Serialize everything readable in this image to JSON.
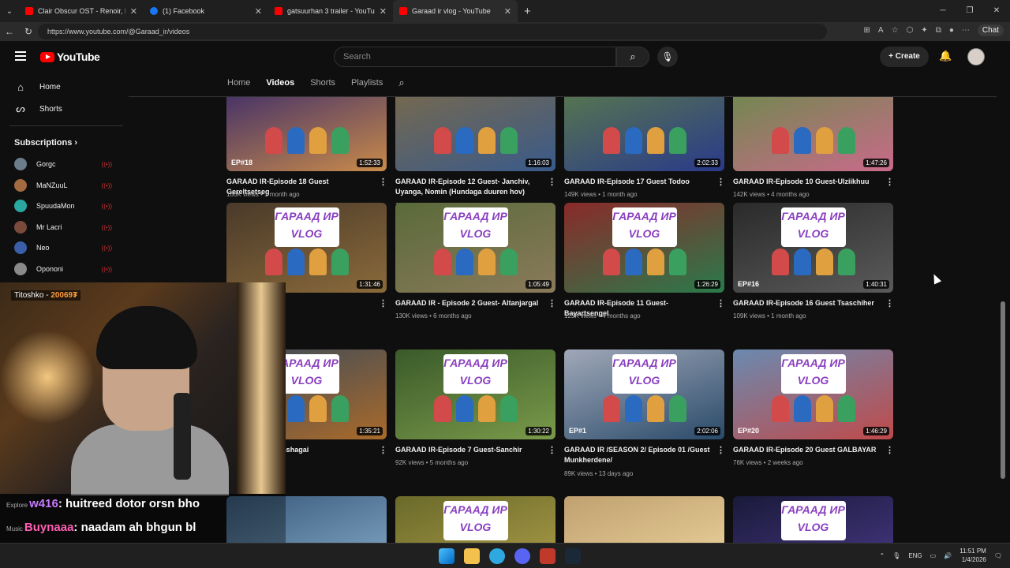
{
  "browser": {
    "tabs": [
      {
        "title": "Clair Obscur OST - Renoir, Il",
        "color": "#ff0000"
      },
      {
        "title": "(1) Facebook",
        "color": "#1877f2"
      },
      {
        "title": "gatsuurhan 3 trailer - YouTube",
        "color": "#ff0000"
      },
      {
        "title": "Garaad ir vlog - YouTube",
        "color": "#ff0000"
      }
    ],
    "url": "https://www.youtube.com/@Garaad_ir/videos",
    "chat_label": "Chat"
  },
  "youtube": {
    "logo_text": "YouTube",
    "search_placeholder": "Search",
    "create_label": "Create"
  },
  "sidebar": {
    "home": "Home",
    "shorts": "Shorts",
    "subscriptions_header": "Subscriptions",
    "subscriptions": [
      {
        "name": "Gorgc",
        "color": "#6b7c8a"
      },
      {
        "name": "MaNZuuL",
        "color": "#a36b3f"
      },
      {
        "name": "SpuudaMon",
        "color": "#2aa7a0"
      },
      {
        "name": "Mr Lacri",
        "color": "#7a4a3a"
      },
      {
        "name": "Neo",
        "color": "#3a5fa8"
      },
      {
        "name": "Opononi",
        "color": "#8a8a8a"
      }
    ]
  },
  "channel_tabs": [
    "Home",
    "Videos",
    "Shorts",
    "Playlists"
  ],
  "videos": [
    {
      "title": "GARAAD IR-Episode 18 Guest Gereltsetseg",
      "meta": "166K views • 1 month ago",
      "duration": "1:52:33",
      "ep": "EP#18"
    },
    {
      "title": "GARAAD IR-Episode 12 Guest- Janchiv, Uyanga, Nomin (Hundaga duuren hov)",
      "meta": "152K views • 3 months ago",
      "duration": "1:16:03",
      "ep": ""
    },
    {
      "title": "GARAAD IR-Episode 17 Guest Todoo",
      "meta": "149K views • 1 month ago",
      "duration": "2:02:33",
      "ep": ""
    },
    {
      "title": "GARAAD IR-Episode 10 Guest-Ulziikhuu",
      "meta": "142K views • 4 months ago",
      "duration": "1:47:26",
      "ep": ""
    },
    {
      "title": "de 14 Guest-",
      "meta": "hs ago",
      "duration": "1:31:46",
      "ep": ""
    },
    {
      "title": "GARAAD IR - Episode 2 Guest- Altanjargal",
      "meta": "130K views • 6 months ago",
      "duration": "1:05:49",
      "ep": ""
    },
    {
      "title": "GARAAD IR-Episode 11 Guest- Bayartsengel",
      "meta": "123K views • 4 months ago",
      "duration": "1:26:29",
      "ep": ""
    },
    {
      "title": "GARAAD IR-Episode 16 Guest Tsaschiher",
      "meta": "109K views • 1 month ago",
      "duration": "1:40:31",
      "ep": "EP#16"
    },
    {
      "title": "de 15 Guest Altanshagai",
      "meta": "s ago",
      "duration": "1:35:21",
      "ep": ""
    },
    {
      "title": "GARAAD IR-Episode 7 Guest-Sanchir",
      "meta": "92K views • 5 months ago",
      "duration": "1:30:22",
      "ep": ""
    },
    {
      "title": "GARAAD IR /SEASON 2/ Episode 01 /Guest Munkherdene/",
      "meta": "89K views • 13 days ago",
      "duration": "2:02:06",
      "ep": "EP#1"
    },
    {
      "title": "GARAAD IR-Episode 20 Guest GALBAYAR",
      "meta": "76K views • 2 weeks ago",
      "duration": "1:46:29",
      "ep": "EP#20"
    }
  ],
  "brand_text": "ГАРААД ИР VLOG",
  "stream": {
    "streamer": "Titoshko",
    "count": "20069₮",
    "chat": [
      {
        "tag": "Explore",
        "user": "w416",
        "msg": "huitreed dotor orsn bho"
      },
      {
        "tag": "Music",
        "user": "Buynaaa",
        "msg": "naadam ah bhgun bl"
      }
    ]
  },
  "taskbar": {
    "lang": "ENG",
    "time": "11:51 PM",
    "date": "1/4/2026"
  }
}
